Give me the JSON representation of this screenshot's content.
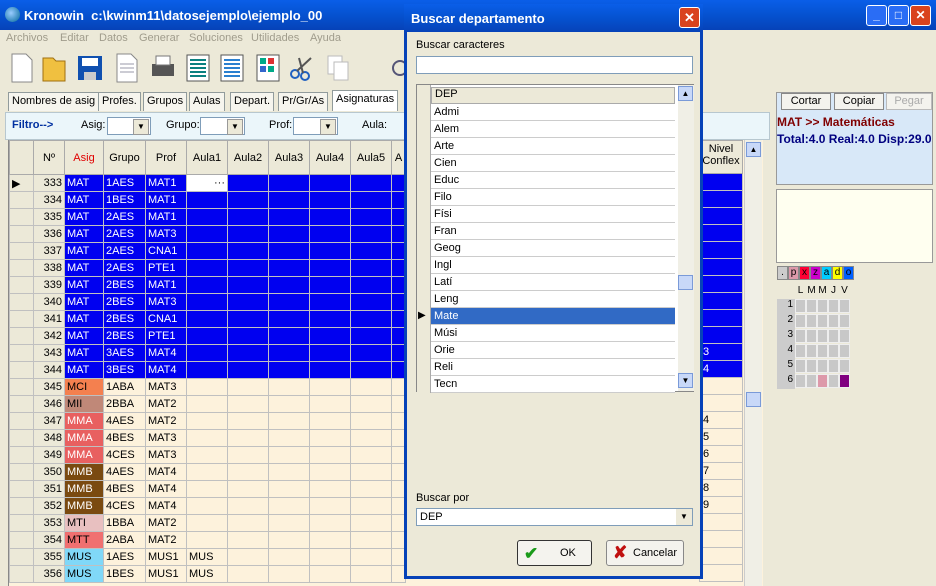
{
  "window": {
    "title": "Kronowin  c:\\kwinm11\\datosejemplo\\ejemplo_00",
    "min": "_",
    "max": "□",
    "close": "✕"
  },
  "menu": [
    "Archivos",
    "Editar",
    "Datos",
    "Generar",
    "Soluciones",
    "Utilidades",
    "Ayuda"
  ],
  "tabs": [
    "Nombres de asig",
    "Profes.",
    "Grupos",
    "Aulas",
    "Depart.",
    "Pr/Gr/As",
    "Asignaturas"
  ],
  "filter": {
    "label": "Filtro-->",
    "asig": "Asig:",
    "grupo": "Grupo:",
    "prof": "Prof:",
    "aula": "Aula:"
  },
  "grid": {
    "headers": [
      "Nº",
      "Asig",
      "Grupo",
      "Prof",
      "Aula1",
      "Aula2",
      "Aula3",
      "Aula4",
      "Aula5",
      "A"
    ],
    "extra_header": "Nivel Conflex",
    "rows": [
      {
        "n": "333",
        "asig": "MAT",
        "grupo": "1AES",
        "prof": "MAT1",
        "aula1": "···",
        "nivel": "",
        "sel": true,
        "color": "#0000f0"
      },
      {
        "n": "334",
        "asig": "MAT",
        "grupo": "1BES",
        "prof": "MAT1",
        "aula1": "",
        "nivel": "",
        "sel": true,
        "color": "#0000f0"
      },
      {
        "n": "335",
        "asig": "MAT",
        "grupo": "2AES",
        "prof": "MAT1",
        "aula1": "",
        "nivel": "",
        "sel": true,
        "color": "#0000f0"
      },
      {
        "n": "336",
        "asig": "MAT",
        "grupo": "2AES",
        "prof": "MAT3",
        "aula1": "",
        "nivel": "",
        "sel": true,
        "color": "#0000f0"
      },
      {
        "n": "337",
        "asig": "MAT",
        "grupo": "2AES",
        "prof": "CNA1",
        "aula1": "",
        "nivel": "",
        "sel": true,
        "color": "#0000f0"
      },
      {
        "n": "338",
        "asig": "MAT",
        "grupo": "2AES",
        "prof": "PTE1",
        "aula1": "",
        "nivel": "",
        "sel": true,
        "color": "#0000f0"
      },
      {
        "n": "339",
        "asig": "MAT",
        "grupo": "2BES",
        "prof": "MAT1",
        "aula1": "",
        "nivel": "",
        "sel": true,
        "color": "#0000f0"
      },
      {
        "n": "340",
        "asig": "MAT",
        "grupo": "2BES",
        "prof": "MAT3",
        "aula1": "",
        "nivel": "",
        "sel": true,
        "color": "#0000f0"
      },
      {
        "n": "341",
        "asig": "MAT",
        "grupo": "2BES",
        "prof": "CNA1",
        "aula1": "",
        "nivel": "",
        "sel": true,
        "color": "#0000f0"
      },
      {
        "n": "342",
        "asig": "MAT",
        "grupo": "2BES",
        "prof": "PTE1",
        "aula1": "",
        "nivel": "",
        "sel": true,
        "color": "#0000f0"
      },
      {
        "n": "343",
        "asig": "MAT",
        "grupo": "3AES",
        "prof": "MAT4",
        "aula1": "",
        "nivel": "3",
        "sel": true,
        "color": "#0000f0"
      },
      {
        "n": "344",
        "asig": "MAT",
        "grupo": "3BES",
        "prof": "MAT4",
        "aula1": "",
        "nivel": "4",
        "sel": true,
        "color": "#0000f0"
      },
      {
        "n": "345",
        "asig": "MCI",
        "grupo": "1ABA",
        "prof": "MAT3",
        "aula1": "",
        "nivel": "",
        "sel": false,
        "color": "#f4804f"
      },
      {
        "n": "346",
        "asig": "MII",
        "grupo": "2BBA",
        "prof": "MAT2",
        "aula1": "",
        "nivel": "",
        "sel": false,
        "color": "#c08878"
      },
      {
        "n": "347",
        "asig": "MMA",
        "grupo": "4AES",
        "prof": "MAT2",
        "aula1": "",
        "nivel": "4",
        "sel": false,
        "color": "#e86060"
      },
      {
        "n": "348",
        "asig": "MMA",
        "grupo": "4BES",
        "prof": "MAT3",
        "aula1": "",
        "nivel": "5",
        "sel": false,
        "color": "#e86060"
      },
      {
        "n": "349",
        "asig": "MMA",
        "grupo": "4CES",
        "prof": "MAT3",
        "aula1": "",
        "nivel": "6",
        "sel": false,
        "color": "#e86060"
      },
      {
        "n": "350",
        "asig": "MMB",
        "grupo": "4AES",
        "prof": "MAT4",
        "aula1": "",
        "nivel": "7",
        "sel": false,
        "color": "#7a4a10"
      },
      {
        "n": "351",
        "asig": "MMB",
        "grupo": "4BES",
        "prof": "MAT4",
        "aula1": "",
        "nivel": "8",
        "sel": false,
        "color": "#7a4a10"
      },
      {
        "n": "352",
        "asig": "MMB",
        "grupo": "4CES",
        "prof": "MAT4",
        "aula1": "",
        "nivel": "9",
        "sel": false,
        "color": "#7a4a10"
      },
      {
        "n": "353",
        "asig": "MTI",
        "grupo": "1BBA",
        "prof": "MAT2",
        "aula1": "",
        "nivel": "",
        "sel": false,
        "color": "#e8c0c0"
      },
      {
        "n": "354",
        "asig": "MTT",
        "grupo": "2ABA",
        "prof": "MAT2",
        "aula1": "",
        "nivel": "",
        "sel": false,
        "color": "#f07070"
      },
      {
        "n": "355",
        "asig": "MUS",
        "grupo": "1AES",
        "prof": "MUS1",
        "aula1": "MUS",
        "nivel": "",
        "sel": false,
        "color": "#80d8f8"
      },
      {
        "n": "356",
        "asig": "MUS",
        "grupo": "1BES",
        "prof": "MUS1",
        "aula1": "MUS",
        "nivel": "",
        "sel": false,
        "color": "#80d8f8"
      }
    ]
  },
  "dialog": {
    "title": "Buscar departamento",
    "close": "✕",
    "search_label": "Buscar caracteres",
    "search_value": "",
    "col_header": "DEP",
    "items": [
      "Admi",
      "Alem",
      "Arte",
      "Cien",
      "Educ",
      "Filo",
      "Físi",
      "Fran",
      "Geog",
      "Ingl",
      "Latí",
      "Leng",
      "Mate",
      "Músi",
      "Orie",
      "Reli",
      "Tecn"
    ],
    "selected_index": 12,
    "buscar_por_label": "Buscar por",
    "buscar_por_value": "DEP",
    "ok": "OK",
    "cancel": "Cancelar"
  },
  "right": {
    "cortar": "Cortar",
    "copiar": "Copiar",
    "pegar": "Pegar",
    "line1": "MAT >> Matemáticas",
    "line2": "Total:4.0 Real:4.0 Disp:29.0",
    "legend": [
      ".",
      "p",
      "x",
      "z",
      "a",
      "d",
      "o"
    ],
    "days": [
      "L",
      "M",
      "M",
      "J",
      "V"
    ],
    "hours": [
      "1",
      "2",
      "3",
      "4",
      "5",
      "6"
    ]
  }
}
